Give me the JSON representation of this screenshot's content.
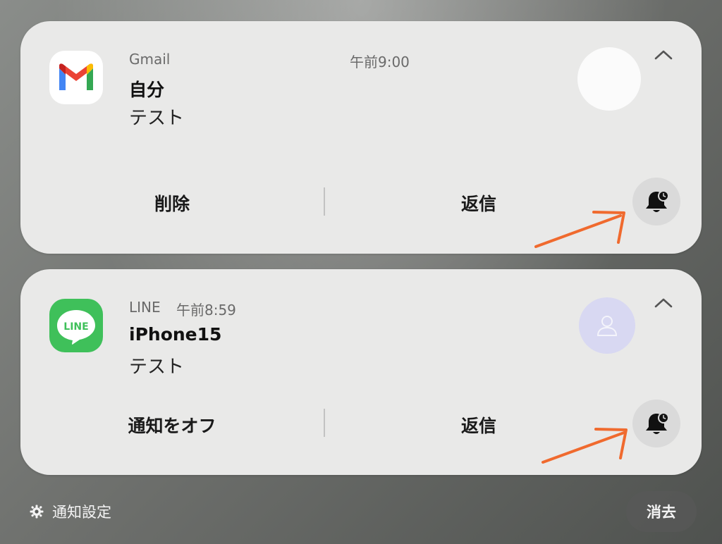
{
  "notifications": [
    {
      "app_name": "Gmail",
      "time": "午前9:00",
      "sender": "自分",
      "message": "テスト",
      "actions": [
        "削除",
        "返信"
      ],
      "app_icon": "gmail-icon"
    },
    {
      "app_name": "LINE",
      "app_icon_text": "LINE",
      "time": "午前8:59",
      "sender": "iPhone15",
      "message": "テスト",
      "actions": [
        "通知をオフ",
        "返信"
      ],
      "app_icon": "line-icon"
    }
  ],
  "footer": {
    "settings_label": "通知設定",
    "clear_label": "消去"
  },
  "colors": {
    "card_bg": "#e9e9e8",
    "line_green": "#3fc05a",
    "annotation_arrow": "#f06a2e",
    "avatar_placeholder": "#d8d8f2"
  }
}
